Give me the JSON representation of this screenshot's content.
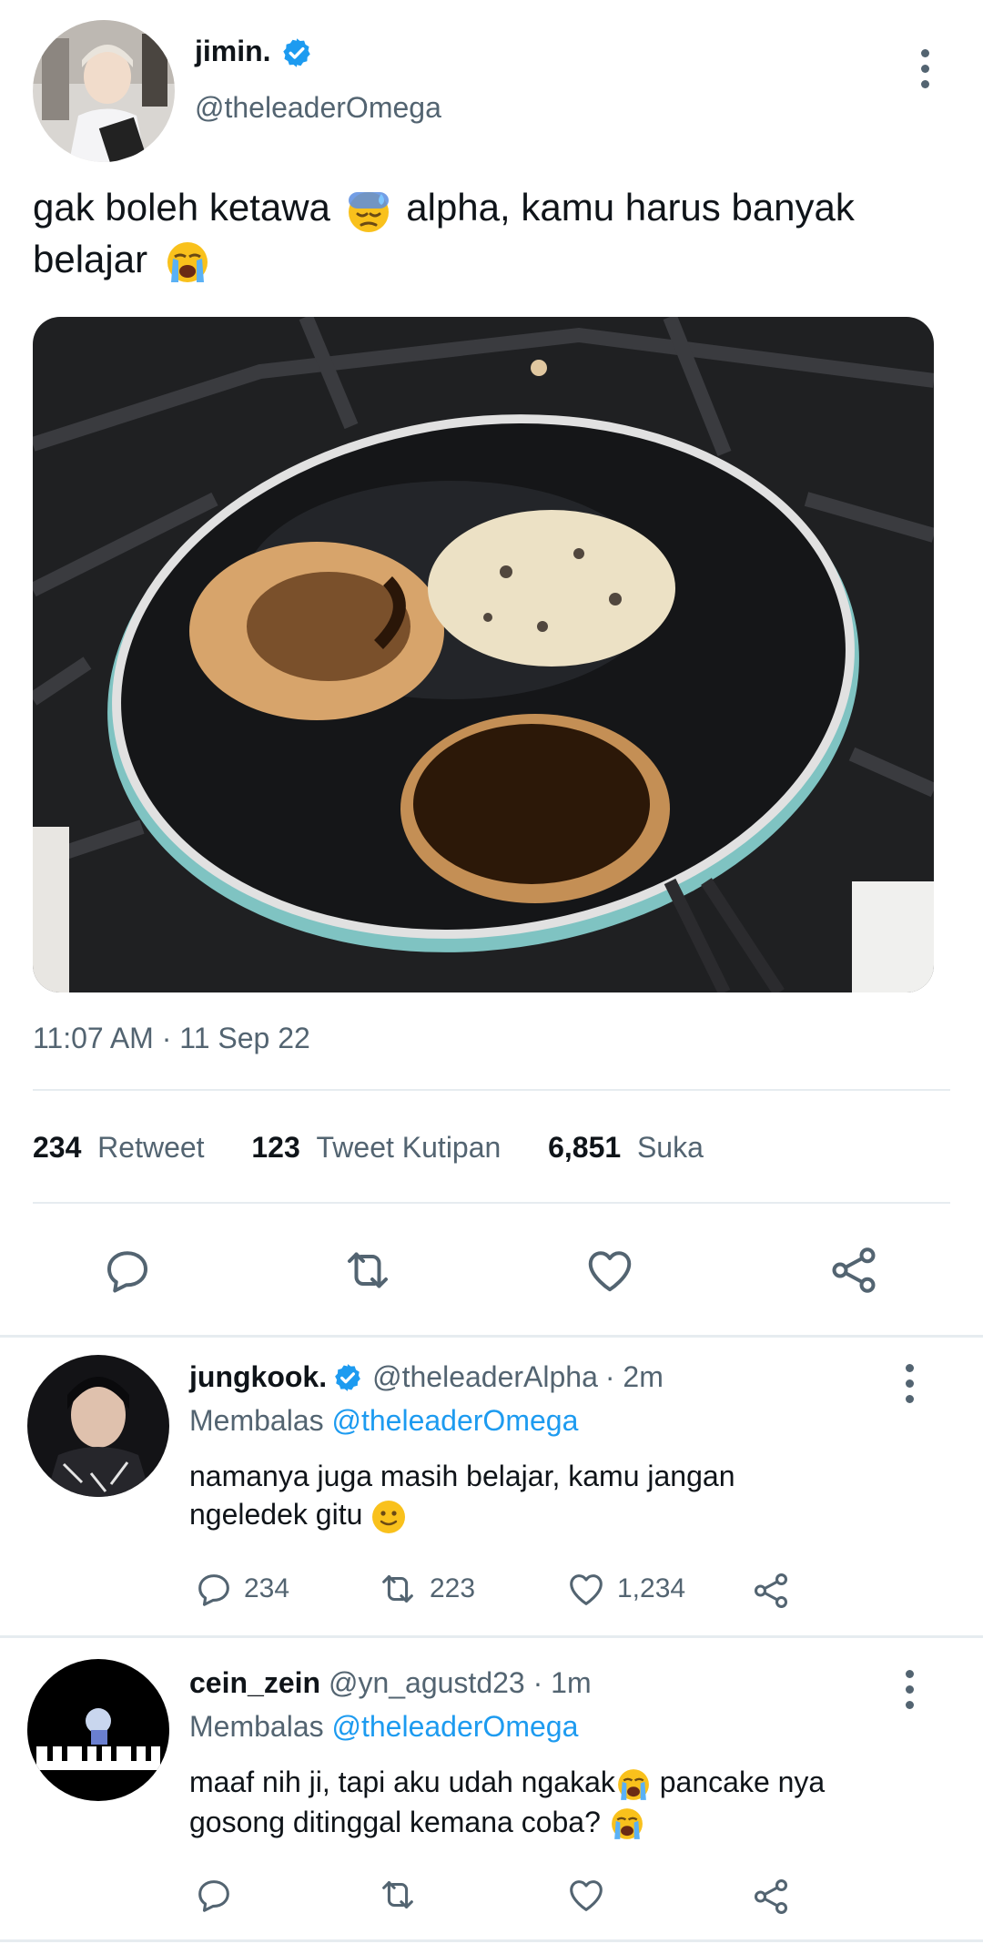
{
  "main_tweet": {
    "display_name": "jimin.",
    "handle": "@theleaderOmega",
    "text_part1": "gak boleh ketawa",
    "text_part2": "alpha, kamu harus banyak",
    "text_part3": "belajar",
    "timestamp": "11:07 AM · 11 Sep 22",
    "stats": {
      "retweets": "234",
      "retweets_label": "Retweet",
      "quotes": "123",
      "quotes_label": "Tweet Kutipan",
      "likes": "6,851",
      "likes_label": "Suka"
    }
  },
  "replies": [
    {
      "display_name": "jungkook.",
      "handle": "@theleaderAlpha",
      "time": "· 2m",
      "replying_label": "Membalas",
      "replying_to": "@theleaderOmega",
      "text_line1": "namanya juga masih belajar, kamu jangan",
      "text_line2": "ngeledek gitu",
      "reply_count": "234",
      "retweet_count": "223",
      "like_count": "1,234"
    },
    {
      "display_name": "cein_zein",
      "handle": "@yn_agustd23",
      "time": "· 1m",
      "replying_label": "Membalas",
      "replying_to": "@theleaderOmega",
      "text_line1a": "maaf nih ji, tapi aku udah ngakak",
      "text_line1b": "pancake nya",
      "text_line2": "gosong ditinggal kemana coba?"
    }
  ],
  "colors": {
    "accent": "#1d9bf0",
    "muted": "#536471"
  }
}
